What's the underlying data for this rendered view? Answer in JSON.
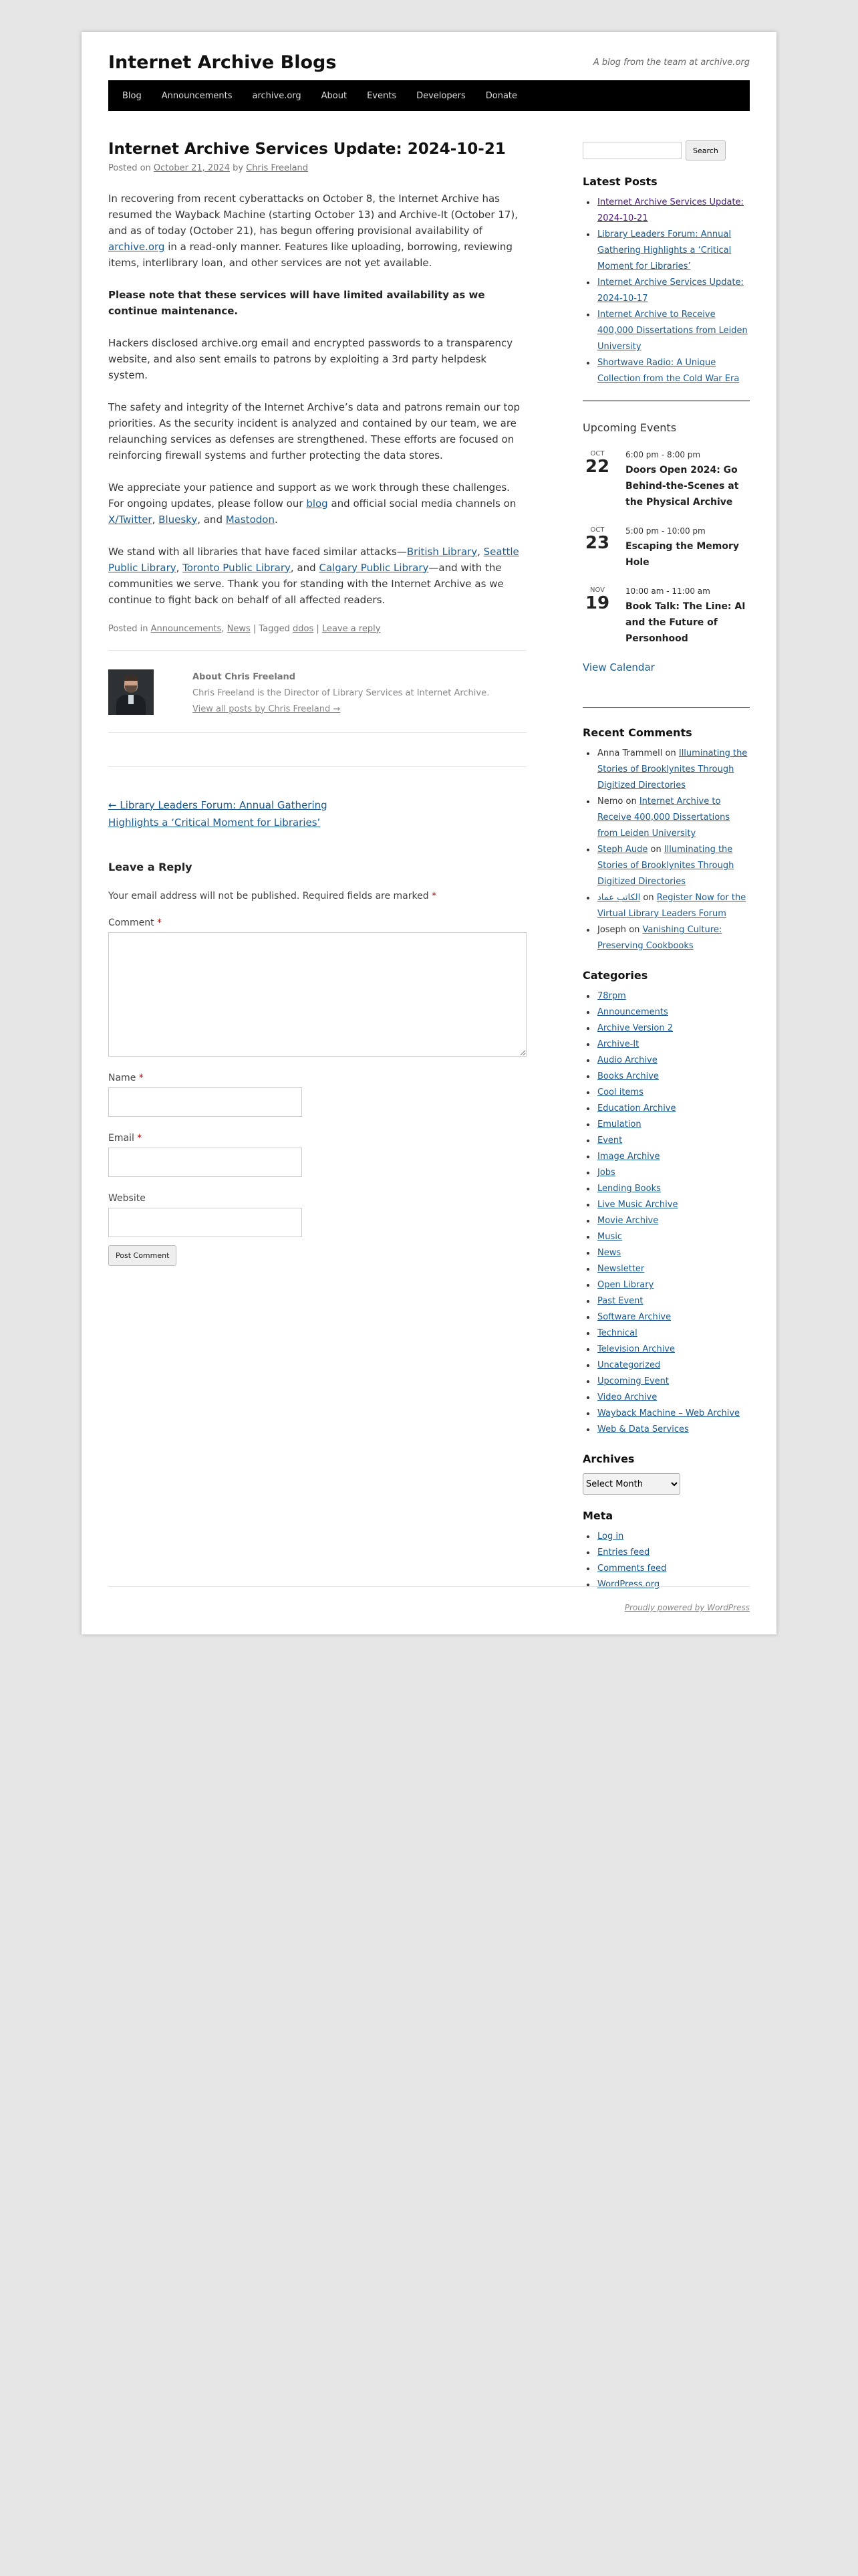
{
  "site": {
    "title": "Internet Archive Blogs",
    "description": "A blog from the team at archive.org",
    "nav": [
      "Blog",
      "Announcements",
      "archive.org",
      "About",
      "Events",
      "Developers",
      "Donate"
    ]
  },
  "post": {
    "title": "Internet Archive Services Update: 2024-10-21",
    "posted_on": "Posted on",
    "date": "October 21, 2024",
    "by": "by",
    "author": "Chris Freeland",
    "p1_a": "In recovering from recent cyberattacks on October 8, the Internet Archive has resumed the Wayback Machine (starting October 13) and Archive-It (October 17), and as of today (October 21), has begun offering provisional availability of ",
    "p1_link": "archive.org",
    "p1_b": " in a read-only manner. Features like uploading, borrowing, reviewing items, interlibrary loan, and other services are not yet available.",
    "p2": "Please note that these services will have limited availability as we continue maintenance.",
    "p3": "Hackers disclosed archive.org email and encrypted passwords to a transparency website, and also sent emails to patrons by exploiting a 3rd party helpdesk system.",
    "p4": "The safety and integrity of the Internet Archive’s data and patrons remain our top priorities. As the security incident is analyzed and contained by our team, we are relaunching services as defenses are strengthened. These efforts are focused on reinforcing firewall systems and further protecting the data stores.",
    "p5_a": "We appreciate your patience and support as we work through these challenges. For ongoing updates, please follow our ",
    "p5_blog": "blog",
    "p5_b": " and official social media channels on ",
    "p5_x": "X/Twitter",
    "p5_c": ", ",
    "p5_bluesky": "Bluesky",
    "p5_d": ", and ",
    "p5_mastodon": "Mastodon",
    "p5_e": ".",
    "p6_a": "We stand with all libraries that have faced similar attacks—",
    "p6_l1": "British Library",
    "p6_sep1": ", ",
    "p6_l2": "Seattle Public Library",
    "p6_sep2": ", ",
    "p6_l3": "Toronto Public Library",
    "p6_sep3": ", and ",
    "p6_l4": "Calgary Public Library",
    "p6_b": "—and with the communities we serve. Thank you for standing with the Internet Archive as we continue to fight back on behalf of all affected readers.",
    "utility": {
      "posted_in": "Posted in",
      "cat1": "Announcements",
      "comma": ",",
      "cat2": "News",
      "tagged": "| Tagged",
      "tag": "ddos",
      "pipe": "|",
      "leave_reply": "Leave a reply"
    }
  },
  "author_box": {
    "title": "About Chris Freeland",
    "bio": "Chris Freeland is the Director of Library Services at Internet Archive.",
    "view_all": "View all posts by Chris Freeland →"
  },
  "post_nav": {
    "prev": "← Library Leaders Forum: Annual Gathering",
    "next": "Highlights a ‘Critical Moment for Libraries’"
  },
  "reply": {
    "title": "Leave a Reply",
    "notes": "Your email address will not be published. Required fields are marked",
    "star": "*",
    "comment_label": "Comment",
    "name_label": "Name",
    "email_label": "Email",
    "website_label": "Website",
    "submit": "Post Comment"
  },
  "sidebar": {
    "search_button": "Search",
    "latest_title": "Latest Posts",
    "latest": [
      "Internet Archive Services Update: 2024-10-21",
      "Library Leaders Forum: Annual Gathering Highlights a ‘Critical Moment for Libraries’",
      "Internet Archive Services Update: 2024-10-17",
      "Internet Archive to Receive 400,000 Dissertations from Leiden University",
      "Shortwave Radio: A Unique Collection from the Cold War Era"
    ],
    "events_title": "Upcoming Events",
    "events": [
      {
        "mon": "OCT",
        "day": "22",
        "time": "6:00 pm - 8:00 pm",
        "name": "Doors Open 2024: Go Behind-the-Scenes at the Physical Archive"
      },
      {
        "mon": "OCT",
        "day": "23",
        "time": "5:00 pm - 10:00 pm",
        "name": "Escaping the Memory Hole"
      },
      {
        "mon": "NOV",
        "day": "19",
        "time": "10:00 am - 11:00 am",
        "name": "Book Talk: The Line: AI and the Future of Personhood"
      }
    ],
    "view_calendar": "View Calendar",
    "comments_title": "Recent Comments",
    "on": "on",
    "comments": [
      {
        "who": "Anna Trammell",
        "post": "Illuminating the Stories of Brooklynites Through Digitized Directories"
      },
      {
        "who": "Nemo",
        "post": "Internet Archive to Receive 400,000 Dissertations from Leiden University"
      },
      {
        "who": "Steph Aude",
        "post": "Illuminating the Stories of Brooklynites Through Digitized Directories"
      },
      {
        "who": "الكاتب عماد",
        "post": "Register Now for the Virtual Library Leaders Forum"
      },
      {
        "who": "Joseph",
        "post": "Vanishing Culture: Preserving Cookbooks"
      }
    ],
    "categories_title": "Categories",
    "categories": [
      "78rpm",
      "Announcements",
      "Archive Version 2",
      "Archive-It",
      "Audio Archive",
      "Books Archive",
      "Cool items",
      "Education Archive",
      "Emulation",
      "Event",
      "Image Archive",
      "Jobs",
      "Lending Books",
      "Live Music Archive",
      "Movie Archive",
      "Music",
      "News",
      "Newsletter",
      "Open Library",
      "Past Event",
      "Software Archive",
      "Technical",
      "Television Archive",
      "Uncategorized",
      "Upcoming Event",
      "Video Archive",
      "Wayback Machine – Web Archive",
      "Web & Data Services"
    ],
    "archives_title": "Archives",
    "archives_select": "Select Month",
    "meta_title": "Meta",
    "meta": [
      "Log in",
      "Entries feed",
      "Comments feed",
      "WordPress.org"
    ]
  },
  "footer": {
    "text": "Proudly powered by WordPress"
  },
  "colors": {
    "link": "#1b5a8e",
    "visited": "#4a1b78",
    "nav_bg": "#000000",
    "required": "#cc0000"
  }
}
